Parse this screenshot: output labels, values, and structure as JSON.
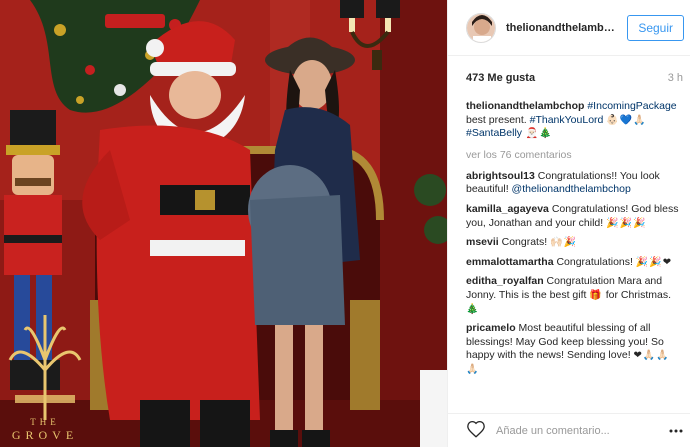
{
  "post": {
    "username": "thelionandthelamb…",
    "follow_label": "Seguir",
    "likes": "473 Me gusta",
    "time": "3 h",
    "photo_watermark": [
      "THE",
      "GROVE"
    ]
  },
  "caption": {
    "author": "thelionandthelambchop",
    "hashtag1": "#IncomingPackage",
    "text1": " best present. ",
    "hashtag2": "#ThankYouLord",
    "emoji1": "👶🏻💙🙏🏻 ",
    "hashtag3": "#SantaBelly",
    "emoji2": " 🎅🏻🎄"
  },
  "view_all": "ver los 76 comentarios",
  "comments": [
    {
      "author": "abrightsoul13",
      "text": " Congratulations!! You look beautiful! ",
      "mention": "@thelionandthelambchop"
    },
    {
      "author": "kamilla_agayeva",
      "text": " Congratulations! God bless you, Jonathan and your child! ",
      "emoji": "🎉🎉🎉"
    },
    {
      "author": "msevii",
      "text": " Congrats! ",
      "emoji": "🙌🏻🎉"
    },
    {
      "author": "emmalottamartha",
      "text": " Congratulations! ",
      "emoji": "🎉🎉❤"
    },
    {
      "author": "editha_royalfan",
      "text": " Congratulation Mara and Jonny. This is the best gift ",
      "emoji": "🎁",
      "text2": " for Christmas. ",
      "emoji2": "🎄"
    },
    {
      "author": "pricamelo",
      "text": " Most beautiful blessing of all blessings! May God keep blessing you! So happy with the news! Sending love! ",
      "emoji": "❤🙏🏻🙏🏻🙏🏻"
    }
  ],
  "comment_input": {
    "placeholder": "Añade un comentario..."
  },
  "icons": [
    "heart-icon",
    "more-options-icon"
  ],
  "colors": {
    "accent": "#3897f0",
    "link": "#003569",
    "muted": "#999999",
    "text": "#262626"
  }
}
